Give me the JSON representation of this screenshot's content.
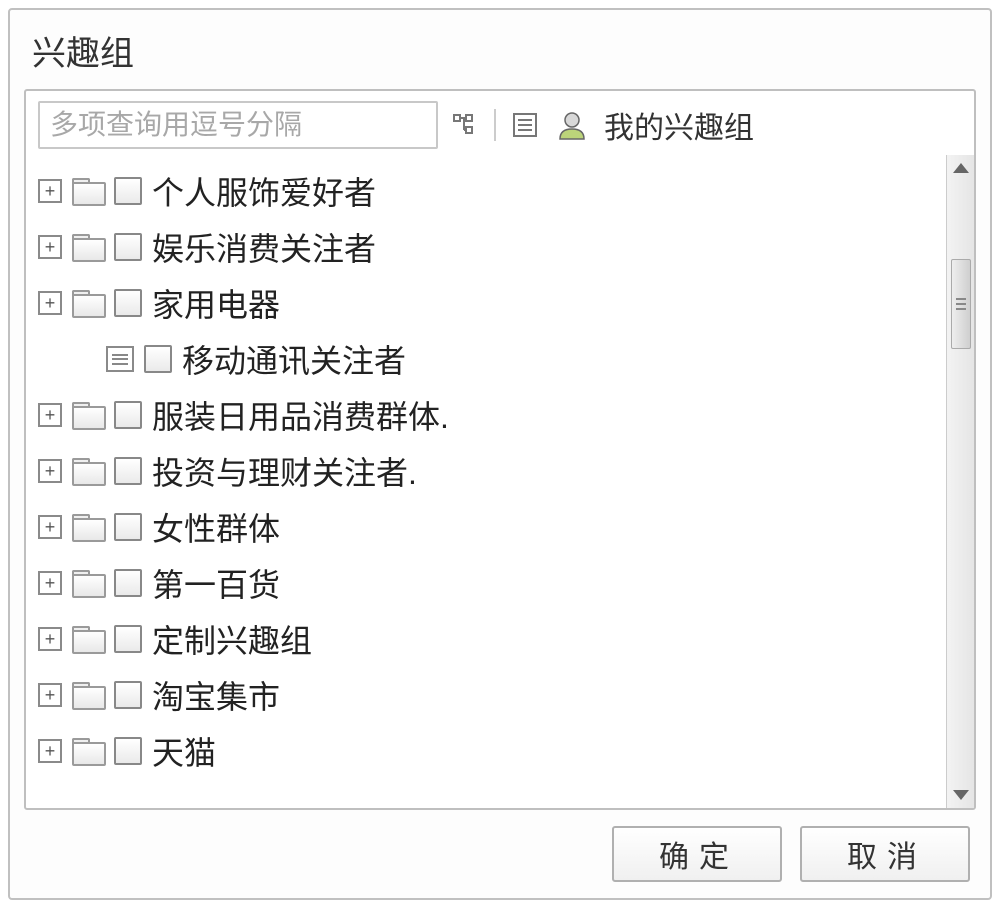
{
  "dialog": {
    "title": "兴趣组"
  },
  "search": {
    "placeholder": "多项查询用逗号分隔"
  },
  "toolbar": {
    "my_groups_label": "我的兴趣组"
  },
  "tree": {
    "items": [
      {
        "type": "folder",
        "expandable": true,
        "label": "个人服饰爱好者"
      },
      {
        "type": "folder",
        "expandable": true,
        "label": "娱乐消费关注者"
      },
      {
        "type": "folder",
        "expandable": true,
        "label": "家用电器"
      },
      {
        "type": "leaf",
        "expandable": false,
        "label": "移动通讯关注者"
      },
      {
        "type": "folder",
        "expandable": true,
        "label": "服装日用品消费群体."
      },
      {
        "type": "folder",
        "expandable": true,
        "label": "投资与理财关注者."
      },
      {
        "type": "folder",
        "expandable": true,
        "label": "女性群体"
      },
      {
        "type": "folder",
        "expandable": true,
        "label": "第一百货"
      },
      {
        "type": "folder",
        "expandable": true,
        "label": "定制兴趣组"
      },
      {
        "type": "folder",
        "expandable": true,
        "label": "淘宝集市"
      },
      {
        "type": "folder",
        "expandable": true,
        "label": "天猫"
      }
    ]
  },
  "buttons": {
    "ok": "确定",
    "cancel": "取消"
  }
}
